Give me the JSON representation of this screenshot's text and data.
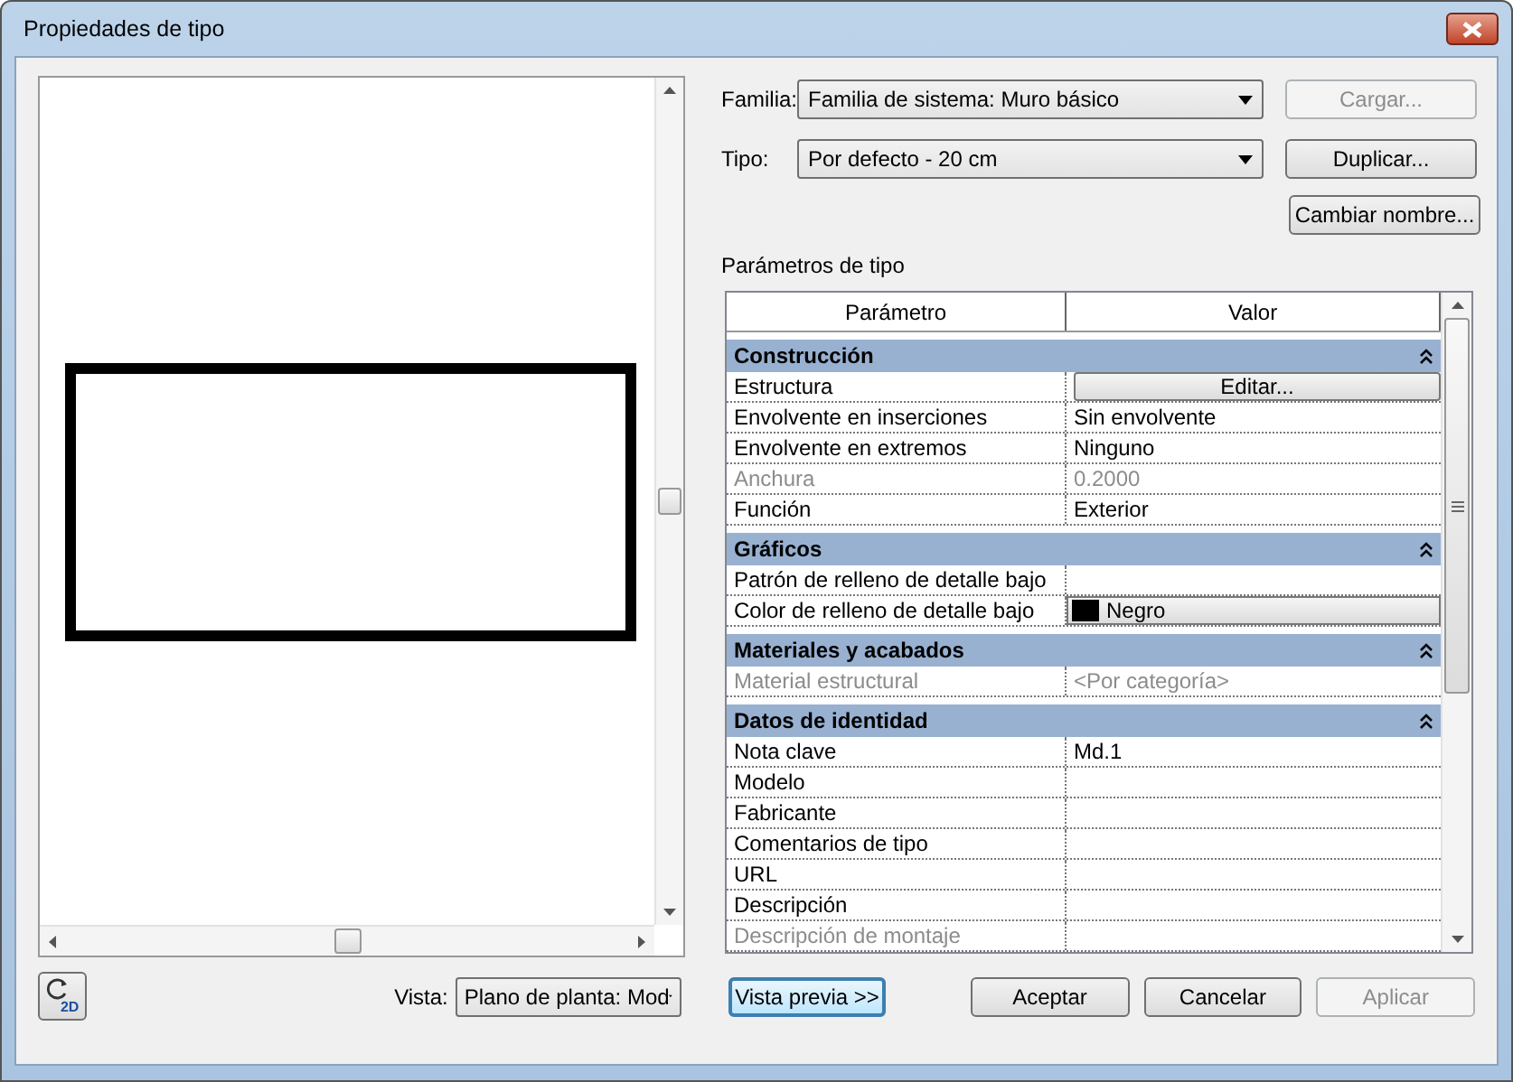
{
  "window": {
    "title": "Propiedades de tipo"
  },
  "family": {
    "label": "Familia:",
    "value": "Familia de sistema: Muro básico"
  },
  "type": {
    "label": "Tipo:",
    "value": "Por defecto - 20 cm"
  },
  "side_buttons": [
    {
      "label": "Cargar...",
      "disabled": true
    },
    {
      "label": "Duplicar...",
      "disabled": false
    },
    {
      "label": "Cambiar nombre...",
      "disabled": false
    }
  ],
  "type_parameters": {
    "title": "Parámetros de tipo",
    "columns": [
      "Parámetro",
      "Valor"
    ],
    "groups": [
      {
        "name": "Construcción",
        "expanded": true,
        "rows": [
          {
            "name": "Estructura",
            "kind": "button",
            "value": "Editar...",
            "disabled": false
          },
          {
            "name": "Envolvente en inserciones",
            "kind": "text",
            "value": "Sin envolvente",
            "disabled": false
          },
          {
            "name": "Envolvente en extremos",
            "kind": "text",
            "value": "Ninguno",
            "disabled": false
          },
          {
            "name": "Anchura",
            "kind": "text",
            "value": "0.2000",
            "disabled": true
          },
          {
            "name": "Función",
            "kind": "text",
            "value": "Exterior",
            "disabled": false
          }
        ]
      },
      {
        "name": "Gráficos",
        "expanded": true,
        "rows": [
          {
            "name": "Patrón de relleno de detalle bajo",
            "kind": "text",
            "disabled": false
          },
          {
            "name": "Color de relleno de detalle bajo",
            "kind": "color",
            "value": "Negro",
            "color": "#000000",
            "disabled": false
          }
        ]
      },
      {
        "name": "Materiales y acabados",
        "expanded": true,
        "rows": [
          {
            "name": "Material estructural",
            "kind": "text",
            "value": "<Por categoría>",
            "disabled": true
          }
        ]
      },
      {
        "name": "Datos de identidad",
        "expanded": true,
        "rows": [
          {
            "name": "Nota clave",
            "kind": "text",
            "value": "Md.1",
            "disabled": false
          },
          {
            "name": "Modelo",
            "kind": "text",
            "disabled": false
          },
          {
            "name": "Fabricante",
            "kind": "text",
            "disabled": false
          },
          {
            "name": "Comentarios de tipo",
            "kind": "text",
            "disabled": false
          },
          {
            "name": "URL",
            "kind": "text",
            "disabled": false
          },
          {
            "name": "Descripción",
            "kind": "text",
            "disabled": false
          },
          {
            "name": "Descripción de montaje",
            "kind": "text",
            "disabled": true
          }
        ]
      }
    ]
  },
  "footer": {
    "icon_text": "2D",
    "view_label": "Vista:",
    "view_value": "Plano de planta: Mod",
    "buttons": [
      {
        "label": "Vista previa >>",
        "focused": true,
        "disabled": false
      },
      {
        "label": "Aceptar",
        "focused": false,
        "disabled": false
      },
      {
        "label": "Cancelar",
        "focused": false,
        "disabled": false
      },
      {
        "label": "Aplicar",
        "focused": false,
        "disabled": true
      }
    ]
  }
}
